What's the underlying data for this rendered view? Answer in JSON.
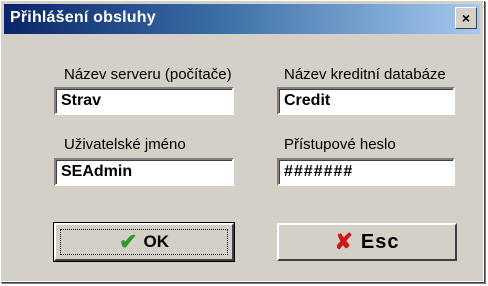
{
  "window": {
    "title": "Přihlášení obsluhy",
    "close_glyph": "×"
  },
  "fields": {
    "server_label": "Název serveru (počítače)",
    "server_value": "Strav",
    "database_label": "Název kreditní databáze",
    "database_value": "Credit",
    "user_label": "Uživatelské jméno",
    "user_value": "SEAdmin",
    "password_label": "Přístupové heslo",
    "password_value": "#######"
  },
  "buttons": {
    "ok_label": "OK",
    "ok_icon": "check-icon",
    "esc_label": "Esc",
    "esc_icon": "x-icon"
  },
  "colors": {
    "titlebar_start": "#0a246a",
    "titlebar_end": "#a6caf0",
    "ok_icon": "#2e9a2e",
    "esc_icon": "#cc1a1a"
  }
}
